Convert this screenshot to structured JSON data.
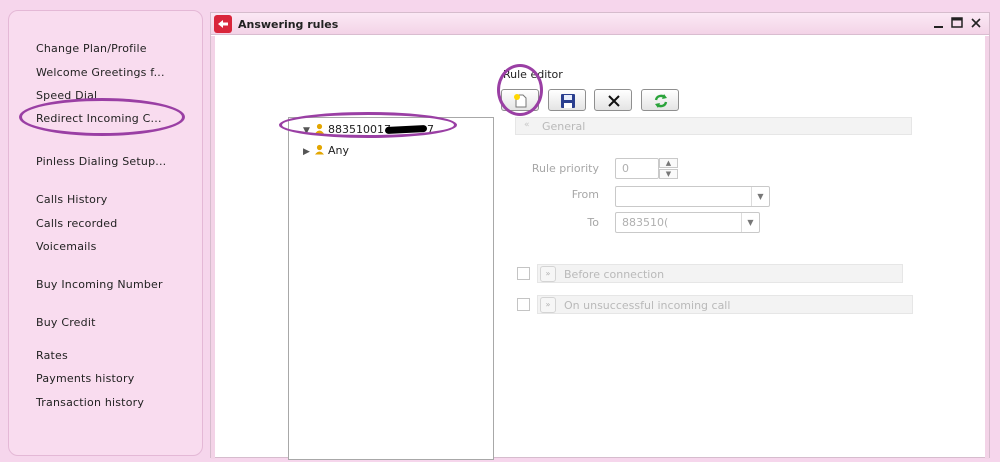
{
  "sidebar": {
    "items": [
      {
        "label": "Change Plan/Profile"
      },
      {
        "label": "Welcome Greetings f..."
      },
      {
        "label": "Speed Dial"
      },
      {
        "label": "Redirect Incoming C..."
      },
      {
        "label": "Pinless Dialing Setup..."
      },
      {
        "label": "Calls History"
      },
      {
        "label": "Calls recorded"
      },
      {
        "label": "Voicemails"
      },
      {
        "label": "Buy Incoming Number"
      },
      {
        "label": "Buy Credit"
      },
      {
        "label": "Rates"
      },
      {
        "label": "Payments history"
      },
      {
        "label": "Transaction history"
      }
    ]
  },
  "window": {
    "title": "Answering rules",
    "icons": {
      "app": "back-arrow-icon",
      "minimize": "minimize-icon",
      "maximize": "maximize-icon",
      "close": "close-icon"
    }
  },
  "tree": {
    "root": {
      "label": "883510017",
      "suffix": "7",
      "expanded": true
    },
    "child": {
      "label": "Any",
      "expanded": false
    }
  },
  "editor": {
    "title": "Rule editor",
    "toolbar": {
      "new": "new-document-icon",
      "save": "save-disk-icon",
      "delete": "delete-x-icon",
      "refresh": "refresh-arrows-icon"
    },
    "general_label": "General",
    "rule_priority_label": "Rule priority",
    "rule_priority_value": "0",
    "from_label": "From",
    "from_value": "",
    "to_label": "To",
    "to_value": "883510(",
    "before_connection_label": "Before connection",
    "unsuccessful_label": "On unsuccessful incoming call"
  },
  "colors": {
    "accent_annotation": "#9a3fa4",
    "sidebar_bg": "#f9dcef",
    "app_icon": "#d9263b"
  }
}
